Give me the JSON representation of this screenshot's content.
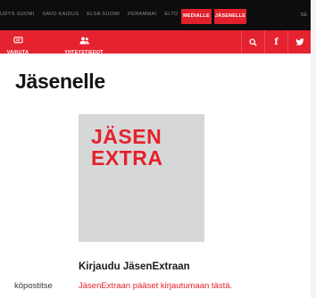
{
  "topbar": {
    "links": [
      "UDYS SUOMI",
      "SAVO KAIDUS",
      "ELSA SUOMI",
      "PERAMMAI",
      "ELTO"
    ],
    "media_button": "MEDIALLE",
    "members_button": "JÄSENELLE",
    "lang": "SE"
  },
  "navbar": {
    "items": [
      {
        "label": "VAIKUTA",
        "icon": "chat-icon"
      },
      {
        "label": "YHTEYSTIEDOT",
        "icon": "people-icon"
      }
    ],
    "icons": [
      "search-icon",
      "facebook-icon",
      "twitter-icon"
    ],
    "facebook_glyph": "f",
    "accent": "#e52230"
  },
  "main": {
    "title": "Jäsenelle",
    "extra_card": {
      "line1": "JÄSEN",
      "line2": "EXTRA",
      "bg": "#d6d7d7"
    },
    "login_title": "Kirjaudu JäsenExtraan",
    "login_link": "JäsenExtraan pääset kirjautumaan tästä.",
    "side_text": "köpostitse"
  }
}
